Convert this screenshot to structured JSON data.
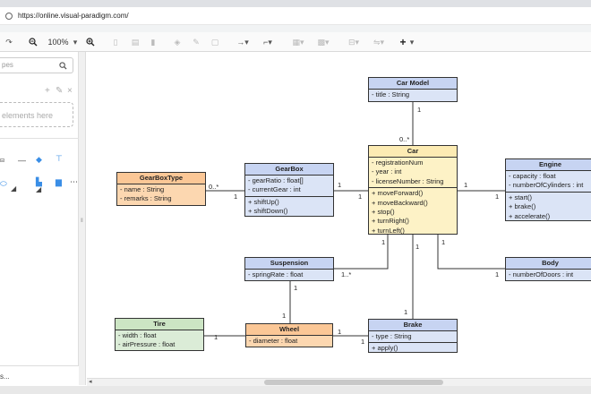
{
  "browser": {
    "url": "https://online.visual-paradigm.com/"
  },
  "toolbar": {
    "redo": "↷",
    "zoom_out": "🔍−",
    "zoom": "100%",
    "zoom_caret": "▾",
    "zoom_in": "⊕",
    "add": "+",
    "add_caret": "▾"
  },
  "sidebar": {
    "search_placeholder": "pes",
    "scratchpad_placeholder": "elements here",
    "more_shapes": "s..."
  },
  "diagram": {
    "classes": {
      "car_model": {
        "name": "Car Model",
        "attrs": [
          "- title : String"
        ],
        "ops": []
      },
      "car": {
        "name": "Car",
        "attrs": [
          "- registrationNum",
          "- year : int",
          "- licenseNumber : String"
        ],
        "ops": [
          "+ moveForward()",
          "+ moveBackward()",
          "+ stop()",
          "+ turnRight()",
          "+ turnLeft()"
        ]
      },
      "gearboxtype": {
        "name": "GearBoxType",
        "attrs": [
          "- name : String",
          "- remarks : String"
        ],
        "ops": []
      },
      "gearbox": {
        "name": "GearBox",
        "attrs": [
          "- gearRatio : float[]",
          "- currentGear : int"
        ],
        "ops": [
          "+ shiftUp()",
          "+ shiftDown()"
        ]
      },
      "engine": {
        "name": "Engine",
        "attrs": [
          "- capacity : float",
          "- numberOfCylinders : int"
        ],
        "ops": [
          "+ start()",
          "+ brake()",
          "+ accelerate()"
        ]
      },
      "suspension": {
        "name": "Suspension",
        "attrs": [
          "- springRate : float"
        ],
        "ops": []
      },
      "body": {
        "name": "Body",
        "attrs": [
          "- numberOfDoors : int"
        ],
        "ops": []
      },
      "tire": {
        "name": "Tire",
        "attrs": [
          "- width : float",
          "- airPressure : float"
        ],
        "ops": []
      },
      "wheel": {
        "name": "Wheel",
        "attrs": [
          "- diameter : float"
        ],
        "ops": []
      },
      "brake": {
        "name": "Brake",
        "attrs": [
          "- type : String"
        ],
        "ops": [
          "+ apply()"
        ]
      }
    },
    "multiplicities": {
      "carmodel_top": "1",
      "car_top": "0..*",
      "gbt_right": "0..*",
      "gb_left": "1",
      "gb_right": "1",
      "car_left": "1",
      "car_right": "1",
      "engine_left": "1",
      "car_bottom_left": "1",
      "car_bottom_mid": "1",
      "car_bottom_right": "1",
      "susp_right": "1..*",
      "susp_bottom": "1",
      "wheel_top": "1",
      "tire_right": "1",
      "wheel_right": "1",
      "brake_left": "1",
      "brake_top": "1",
      "body_left": "1"
    }
  }
}
